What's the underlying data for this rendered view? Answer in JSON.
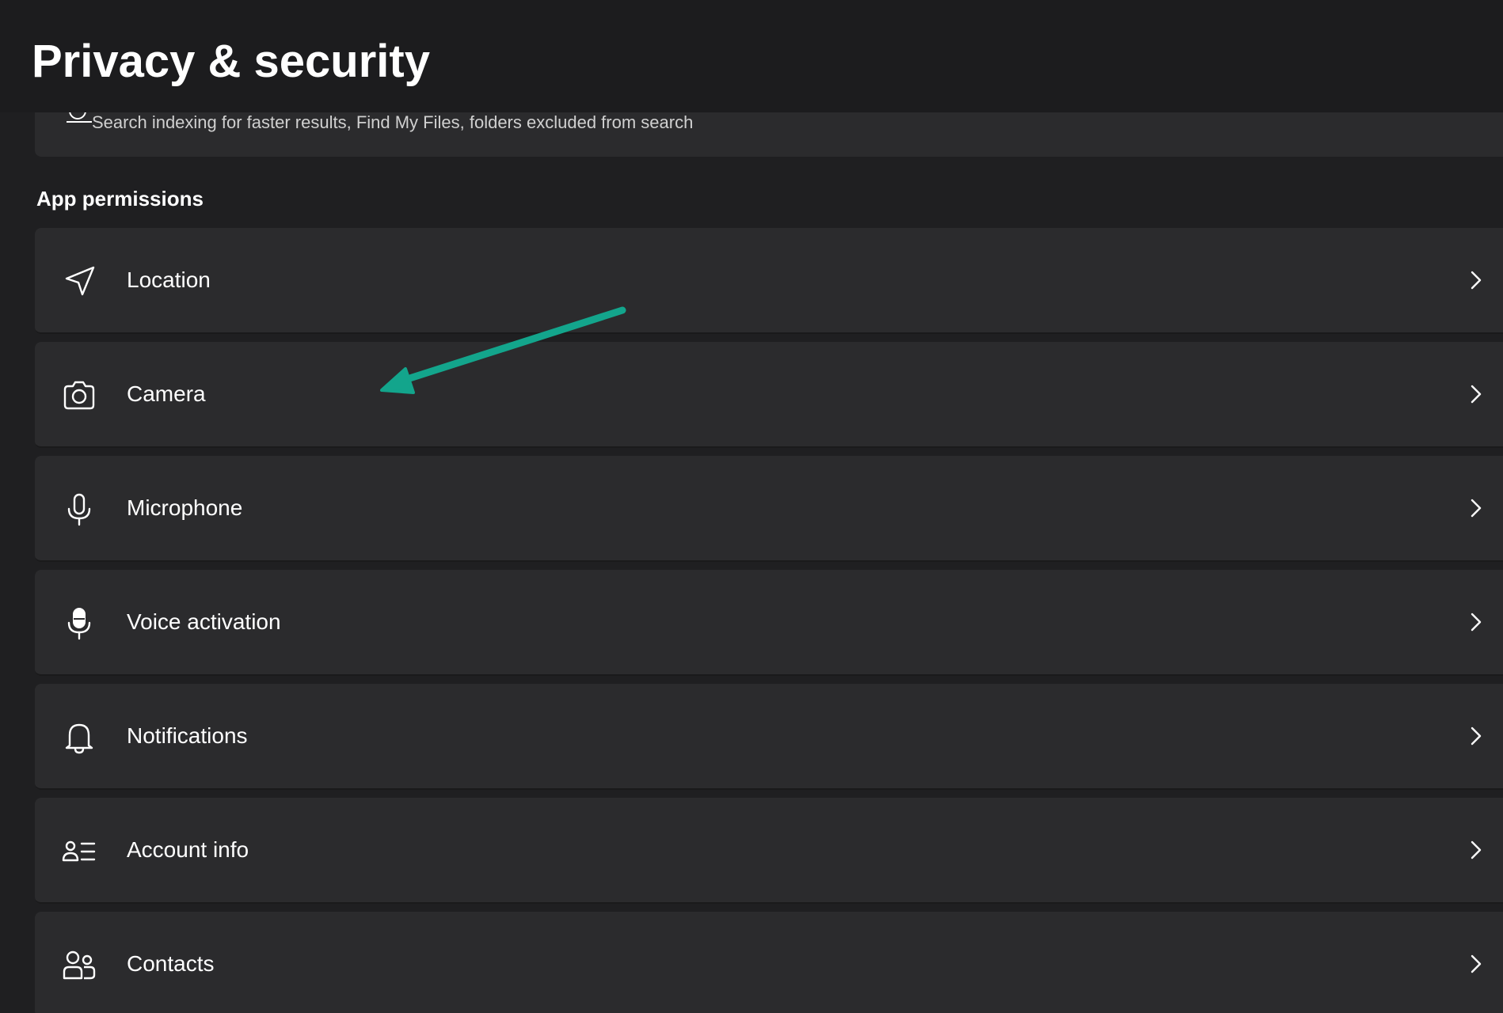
{
  "page": {
    "title": "Privacy & security"
  },
  "search_card": {
    "description": "Search indexing for faster results, Find My Files, folders excluded from search",
    "icon": "search-windows-icon"
  },
  "app_permissions": {
    "header": "App permissions",
    "items": [
      {
        "label": "Location",
        "icon": "location-arrow-icon"
      },
      {
        "label": "Camera",
        "icon": "camera-icon"
      },
      {
        "label": "Microphone",
        "icon": "microphone-icon"
      },
      {
        "label": "Voice activation",
        "icon": "voice-activation-icon"
      },
      {
        "label": "Notifications",
        "icon": "bell-icon"
      },
      {
        "label": "Account info",
        "icon": "account-info-icon"
      },
      {
        "label": "Contacts",
        "icon": "contacts-icon"
      }
    ]
  },
  "annotation": {
    "arrow_color": "#13a58c",
    "points_to": "Camera"
  },
  "colors": {
    "background": "#1f1f21",
    "card": "#2b2b2d",
    "text": "#ffffff"
  }
}
